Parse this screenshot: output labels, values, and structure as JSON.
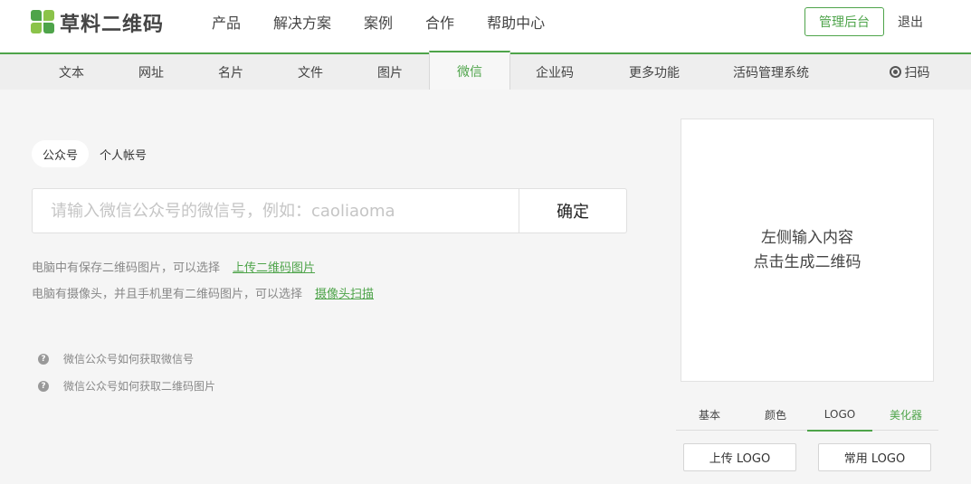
{
  "brand": {
    "name": "草料二维码",
    "colors": {
      "accent": "#4ea44a"
    }
  },
  "mainnav": [
    "产品",
    "解决方案",
    "案例",
    "合作",
    "帮助中心"
  ],
  "header": {
    "admin_label": "管理后台",
    "logout_label": "退出"
  },
  "subnav": {
    "tabs": [
      "文本",
      "网址",
      "名片",
      "文件",
      "图片",
      "微信",
      "企业码",
      "更多功能",
      "活码管理系统"
    ],
    "active": "微信",
    "scan_label": "扫码"
  },
  "wechat": {
    "type_tabs": [
      "公众号",
      "个人帐号"
    ],
    "active_type": "公众号",
    "input_placeholder": "请输入微信公众号的微信号，例如：caoliaoma",
    "input_value": "",
    "confirm_label": "确定"
  },
  "hints": [
    {
      "text": "电脑中有保存二维码图片，可以选择",
      "link": "上传二维码图片"
    },
    {
      "text": "电脑有摄像头，并且手机里有二维码图片，可以选择",
      "link": "摄像头扫描"
    }
  ],
  "help": [
    "微信公众号如何获取微信号",
    "微信公众号如何获取二维码图片"
  ],
  "preview": {
    "line1": "左侧输入内容",
    "line2": "点击生成二维码"
  },
  "style_tabs": [
    "基本",
    "颜色",
    "LOGO",
    "美化器"
  ],
  "style_active": "LOGO",
  "logo_buttons": {
    "upload": "上传 LOGO",
    "common": "常用 LOGO"
  }
}
